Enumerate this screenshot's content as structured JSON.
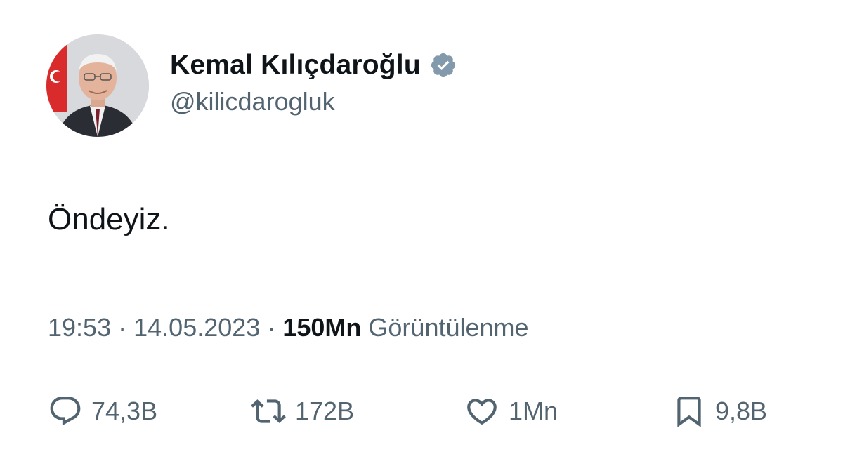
{
  "author": {
    "display_name": "Kemal Kılıçdaroğlu",
    "handle": "@kilicdarogluk",
    "verified": true
  },
  "tweet": {
    "text": "Öndeyiz."
  },
  "meta": {
    "time": "19:53",
    "separator": "·",
    "date": "14.05.2023",
    "views_count": "150Mn",
    "views_label": "Görüntülenme"
  },
  "actions": {
    "replies": "74,3B",
    "retweets": "172B",
    "likes": "1Mn",
    "bookmarks": "9,8B"
  },
  "colors": {
    "text_primary": "#0f1419",
    "text_secondary": "#536471",
    "verified_badge": "#829aab"
  },
  "icons": {
    "reply": "reply-icon",
    "retweet": "retweet-icon",
    "like": "heart-icon",
    "bookmark": "bookmark-icon",
    "verified": "verified-badge-icon"
  }
}
